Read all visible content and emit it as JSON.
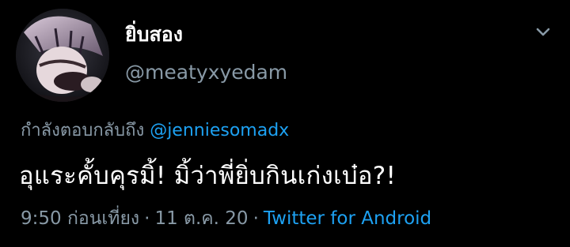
{
  "tweet": {
    "display_name": "ยิ่บสอง",
    "handle": "@meatyxyedam",
    "reply_prefix": "กำลังตอบกลับถึง ",
    "reply_mention": "@jenniesomadx",
    "text": "อุแระคั้บคุรมิ้! มิ้ว่าพี่ยิ่บกินเก่งเบ๋อ?!",
    "time": "9:50 ก่อนเที่ยง",
    "separator": "·",
    "date": "11 ต.ค. 20",
    "source": "Twitter for Android"
  },
  "icons": {
    "avatar": "profile-photo",
    "menu": "chevron-down-icon"
  },
  "colors": {
    "background": "#000000",
    "primary_text": "#ffffff",
    "secondary_text": "#8899a6",
    "link": "#1da1f2"
  }
}
